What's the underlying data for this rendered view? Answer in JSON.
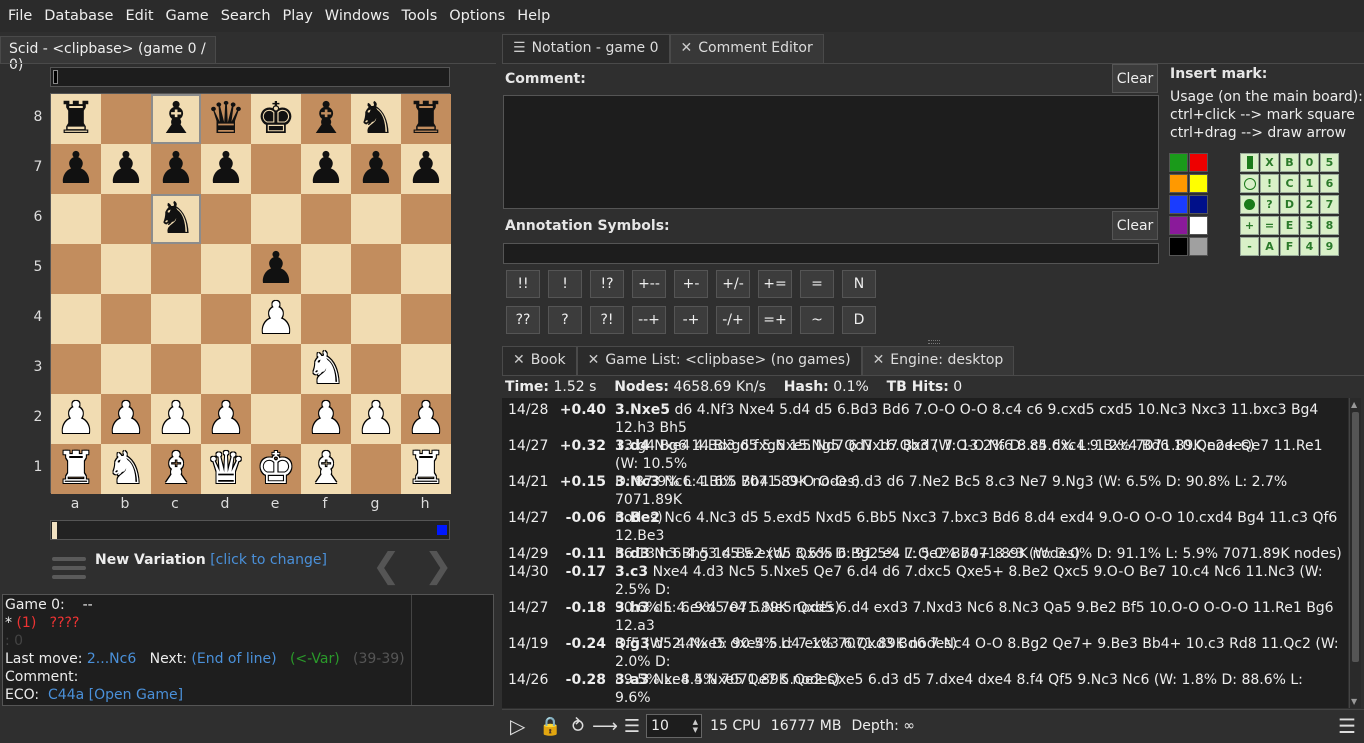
{
  "menu": [
    "File",
    "Database",
    "Edit",
    "Game",
    "Search",
    "Play",
    "Windows",
    "Tools",
    "Options",
    "Help"
  ],
  "left_tab": "Scid - <clipbase> (game 0 / 0)",
  "board": {
    "rows": [
      [
        "r",
        "",
        "b",
        "q",
        "k",
        "b",
        "n",
        "r"
      ],
      [
        "p",
        "p",
        "p",
        "p",
        "",
        "p",
        "p",
        "p"
      ],
      [
        "",
        "",
        "n",
        "",
        "",
        "",
        "",
        ""
      ],
      [
        "",
        "",
        "",
        "",
        "p",
        "",
        "",
        ""
      ],
      [
        "",
        "",
        "",
        "",
        "P",
        "",
        "",
        ""
      ],
      [
        "",
        "",
        "",
        "",
        "",
        "N",
        "",
        ""
      ],
      [
        "P",
        "P",
        "P",
        "P",
        "",
        "P",
        "P",
        "P"
      ],
      [
        "R",
        "N",
        "B",
        "Q",
        "K",
        "B",
        "",
        "R"
      ]
    ],
    "ranks": [
      "8",
      "7",
      "6",
      "5",
      "4",
      "3",
      "2",
      "1"
    ],
    "files": [
      "a",
      "b",
      "c",
      "d",
      "e",
      "f",
      "g",
      "h"
    ]
  },
  "variation": {
    "label": "New Variation",
    "hint": "[click to change]"
  },
  "info": {
    "game": "Game 0:",
    "game_val": "--",
    "star": "*",
    "star_val": "(1)",
    "star_q": "????",
    "dim": ":  0",
    "lastmove_lbl": "Last move:",
    "lastmove": "2...Nc6",
    "next_lbl": "Next:",
    "next": "(End of line)",
    "var": "(<-Var)",
    "count": "(39-39)",
    "comment_lbl": "Comment:",
    "eco_lbl": "ECO:",
    "eco": "C44a [Open Game]"
  },
  "right_tabs": {
    "notation": "Notation - game 0",
    "comment": "Comment Editor"
  },
  "comment_editor": {
    "comment_lbl": "Comment:",
    "clear": "Clear",
    "annot_lbl": "Annotation Symbols:",
    "symbols_row1": [
      "!!",
      "!",
      "!?",
      "+--",
      "+-",
      "+/-",
      "+=",
      "=",
      "N"
    ],
    "symbols_row2": [
      "??",
      "?",
      "?!",
      "--+",
      "-+",
      "-/+",
      "=+",
      "~",
      "D"
    ],
    "insert_mark": "Insert mark:",
    "usage": [
      "Usage (on the main board):",
      "ctrl+click --> mark square",
      "ctrl+drag --> draw arrow"
    ],
    "colors": [
      "#1a9a1a",
      "#ee0000",
      "#ff9900",
      "#ffff00",
      "#1a3cff",
      "#00108a",
      "#8a1a9a",
      "#ffffff",
      "#000000",
      "#a0a0a0"
    ],
    "marks": [
      [
        "",
        "X",
        "B",
        "0",
        "5"
      ],
      [
        "",
        "!",
        "C",
        "1",
        "6"
      ],
      [
        "",
        "?",
        "D",
        "2",
        "7"
      ],
      [
        "+",
        "=",
        "E",
        "3",
        "8"
      ],
      [
        "-",
        "A",
        "F",
        "4",
        "9"
      ]
    ]
  },
  "bottom_tabs": {
    "book": "Book",
    "gamelist": "Game List: <clipbase> (no games)",
    "engine": "Engine: desktop"
  },
  "engine_stats": {
    "time_lbl": "Time:",
    "time": "1.52 s",
    "nodes_lbl": "Nodes:",
    "nodes": "4658.69 Kn/s",
    "hash_lbl": "Hash:",
    "hash": "0.1%",
    "tb_lbl": "TB Hits:",
    "tb": "0"
  },
  "engine_lines": [
    {
      "depth": "14/28",
      "score": "+0.40",
      "move": "3.Nxe5",
      "l1": "d6 4.Nf3 Nxe4 5.d4 d5 6.Bd3 Bd6 7.O-O O-O 8.c4 c6 9.cxd5 cxd5 10.Nc3 Nxc3 11.bxc3 Bg4 12.h3 Bh5",
      "l2": "13.g4 Bg6 14.Bxg6 fxg6 15.Ng5 Qd7 16.Qb3  (W: 13.2%  D: 85.6%  L: 1.2%  7071.89K nodes)"
    },
    {
      "depth": "14/27",
      "score": "+0.32",
      "move": "3.d4",
      "l1": "Nxe4 4.Bd3 d5 5.Nxe5 Nd7 6.Nxd7 Bxd7 7.O-O Nf6 8.c4 dxc4 9.Bxc4 Bd6 10.Qe2+ Qe7 11.Re1  (W: 10.5%",
      "l2": "D: 87.9%  L: 1.6%  7071.89K nodes)"
    },
    {
      "depth": "14/21",
      "score": "+0.15",
      "move": "3.Nc3",
      "l1": "Nc6 4.Bb5 Bb4 5.O-O O-O 6.d3 d6 7.Ne2 Bc5 8.c3 Ne7 9.Ng3  (W: 6.5%  D: 90.8%  L: 2.7%  7071.89K",
      "l2": "nodes)"
    },
    {
      "depth": "14/27",
      "score": "-0.06",
      "move": "3.Be2",
      "l1": "Nc6 4.Nc3 d5 5.exd5 Nxd5 6.Bb5 Nxc3 7.bxc3 Bd6 8.d4 exd4 9.O-O O-O 10.cxd4 Bg4 11.c3 Qf6 12.Be3",
      "l2": "h6 13.h3 Bh5 14.Be2  (W: 3.5%  D: 91.5%  L: 5.0%  7071.89K nodes)"
    },
    {
      "depth": "14/29",
      "score": "-0.11",
      "move": "3.d3",
      "l1": "Nc6 4.g3 d5 5.exd5 Qxd5 6.Bg2 e4 7.Qe2 Bb4+ 8.c3  (W: 3.0%  D: 91.1%  L: 5.9%  7071.89K nodes)",
      "l2": ""
    },
    {
      "depth": "14/30",
      "score": "-0.17",
      "move": "3.c3",
      "l1": "Nxe4 4.d3 Nc5 5.Nxe5 Qe7 6.d4 d6 7.dxc5 Qxe5+ 8.Be2 Qxc5 9.O-O Be7 10.c4 Nc6 11.Nc3  (W: 2.5%  D:",
      "l2": "90.6%  L: 6.9%  7071.89K nodes)"
    },
    {
      "depth": "14/27",
      "score": "-0.18",
      "move": "3.h3",
      "l1": "d5 4.exd5 e4 5.Ne5 Qxd5 6.d4 exd3 7.Nxd3 Nc6 8.Nc3 Qa5 9.Be2 Bf5 10.O-O O-O-O 11.Re1 Bg6 12.a3",
      "l2": "Qf5  (W: 2.4%  D: 90.5%  L: 7.1%  7071.89K nodes)"
    },
    {
      "depth": "14/19",
      "score": "-0.24",
      "move": "3.g3",
      "l1": "d5 4.Nxe5 dxe4 5.d4 exd3 6.Qxd3 Bd6 7.Nc4 O-O 8.Bg2 Qe7+ 9.Be3 Bb4+ 10.c3 Rd8 11.Qc2  (W: 2.0%  D:",
      "l2": "89.5%  L: 8.5%  7071.89K nodes)"
    },
    {
      "depth": "14/26",
      "score": "-0.28",
      "move": "3.a3",
      "l1": "Nxe4 4.Nxe5 Qe7 5.Qe2 Qxe5 6.d3 d5 7.dxe4 dxe4 8.f4 Qf5 9.Nc3 Nc6  (W: 1.8%  D: 88.6%  L: 9.6%",
      "l2": "7071.89K nodes)"
    }
  ],
  "engine_bottom": {
    "lines": "10",
    "cpu": "15 CPU",
    "mem": "16777 MB",
    "depth": "Depth: ∞"
  }
}
